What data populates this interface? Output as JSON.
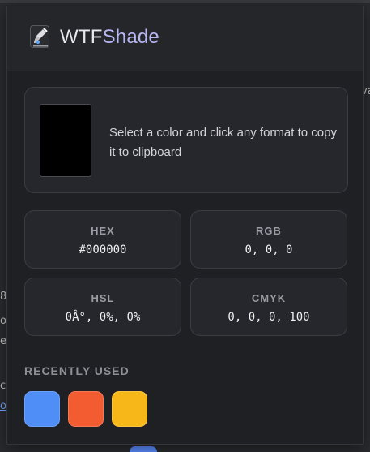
{
  "app": {
    "title_part1": "WTF",
    "title_part2": "Shade",
    "logo_icon": "eyedropper-logo-icon"
  },
  "preview": {
    "color": "#000000",
    "message": "Select a color and click any format to copy it to clipboard"
  },
  "formats": [
    {
      "label": "HEX",
      "value": "#000000"
    },
    {
      "label": "RGB",
      "value": "0, 0, 0"
    },
    {
      "label": "HSL",
      "value": "0Â°, 0%, 0%"
    },
    {
      "label": "CMYK",
      "value": "0, 0, 0, 100"
    }
  ],
  "recent": {
    "title": "RECENTLY USED",
    "colors": [
      "#4f8ef7",
      "#f25c30",
      "#f8b719"
    ]
  },
  "background_page": {
    "fragments": [
      "8",
      "ou",
      "en",
      "c",
      "o",
      "va"
    ]
  }
}
